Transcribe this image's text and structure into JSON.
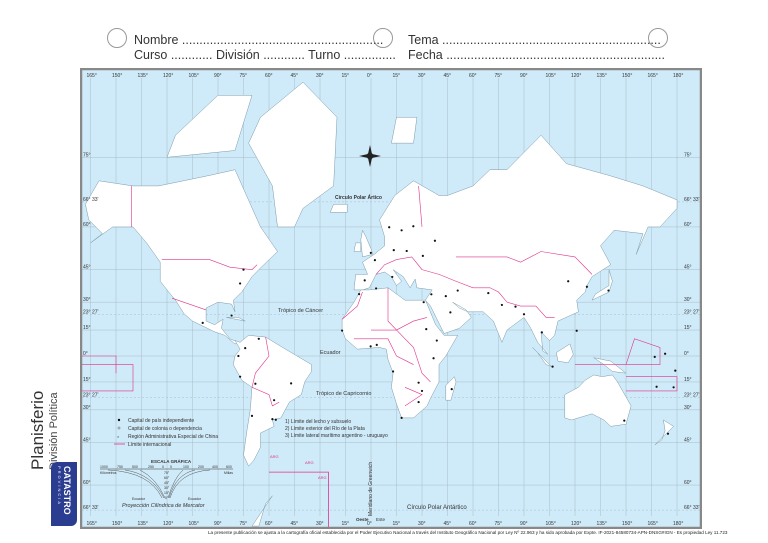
{
  "header": {
    "nombre": "Nombre ..........................................................",
    "curso": "Curso ............ División ............ Turno ...............",
    "tema": "Tema ...............................................................",
    "fecha": "Fecha ..............................................................."
  },
  "sidebar": {
    "title": "Planisferio",
    "subtitle": "División Política",
    "brand": "CATASTRO",
    "brand_sub": "PROVINCIA"
  },
  "map": {
    "lon_labels": [
      "165°",
      "150°",
      "135°",
      "120°",
      "105°",
      "90°",
      "75°",
      "60°",
      "45°",
      "30°",
      "15°",
      "0°",
      "15°",
      "30°",
      "45°",
      "60°",
      "75°",
      "90°",
      "105°",
      "120°",
      "135°",
      "150°",
      "165°",
      "180°"
    ],
    "bottom_lon_labels": [
      "165°",
      "150°",
      "135°",
      "120°",
      "105°",
      "90°",
      "75°",
      "60°",
      "45°",
      "30°",
      "15°",
      "0°",
      "15°",
      "30°",
      "45°",
      "60°",
      "75°",
      "90°",
      "105°",
      "120°",
      "135°",
      "150°",
      "165°",
      "180°"
    ],
    "lat_labels": [
      {
        "lat": 75,
        "label": "75°"
      },
      {
        "lat": 66.55,
        "label": "66° 33'"
      },
      {
        "lat": 60,
        "label": "60°"
      },
      {
        "lat": 45,
        "label": "45°"
      },
      {
        "lat": 30,
        "label": "30°"
      },
      {
        "lat": 23.45,
        "label": "23° 27'"
      },
      {
        "lat": 15,
        "label": "15°"
      },
      {
        "lat": 0,
        "label": "0°"
      },
      {
        "lat": -15,
        "label": "15°"
      },
      {
        "lat": -23.45,
        "label": "23° 27'"
      },
      {
        "lat": -30,
        "label": "30°"
      },
      {
        "lat": -45,
        "label": "45°"
      },
      {
        "lat": -60,
        "label": "60°"
      },
      {
        "lat": -66.55,
        "label": "66° 33'"
      }
    ],
    "circulo_artico": "Círculo Polar Ártico",
    "tropico_cancer": "Trópico de Cáncer",
    "ecuador": "Ecuador",
    "tropico_capricornio": "Trópico de Capricornio",
    "circulo_antartico": "Círculo Polar Antártico",
    "greenwich": "Meridiano de Greenwich",
    "oeste": "Oeste",
    "este": "Este",
    "arg_label": "ARG",
    "colors": {
      "ocean": "#cfeaf8",
      "land": "#ffffff",
      "border": "#e0338a",
      "grid": "#8fa6b3",
      "frame": "#888888"
    }
  },
  "legend": {
    "items": [
      "Capital de país independiente",
      "Capital de colonia o dependencia",
      "Región Administrativa Especial de China",
      "Límite internacional"
    ],
    "notes": [
      "1) Límite del lecho y subsuelo",
      "2) Límite exterior del Río de la Plata",
      "3) Límite lateral marítimo argentino - uruguayo"
    ]
  },
  "scale": {
    "title": "ESCALA GRÁFICA",
    "left_ticks": [
      "1000",
      "750",
      "500",
      "250",
      "0"
    ],
    "right_ticks": [
      "0",
      "100",
      "200",
      "400",
      "600"
    ],
    "left_unit": "Kilómetros",
    "right_unit": "Millas",
    "lat_ticks": [
      "75°",
      "60°",
      "45°",
      "30°",
      "15°",
      "0°"
    ],
    "ecuador_left": "Ecuador",
    "ecuador_right": "Ecuador",
    "projection": "Proyección Cilíndrica de Mercator"
  },
  "footer": "La presente publicación se ajusta a la cartografía oficial establecida por el Poder Ejecutivo Nacional a través del Instituto Geográfico Nacional por Ley Nº 22.963 y ha sido aprobada por Expte. IF-2021-84580734-APN-DNSG#IGN - Es propiedad Ley 11.723"
}
